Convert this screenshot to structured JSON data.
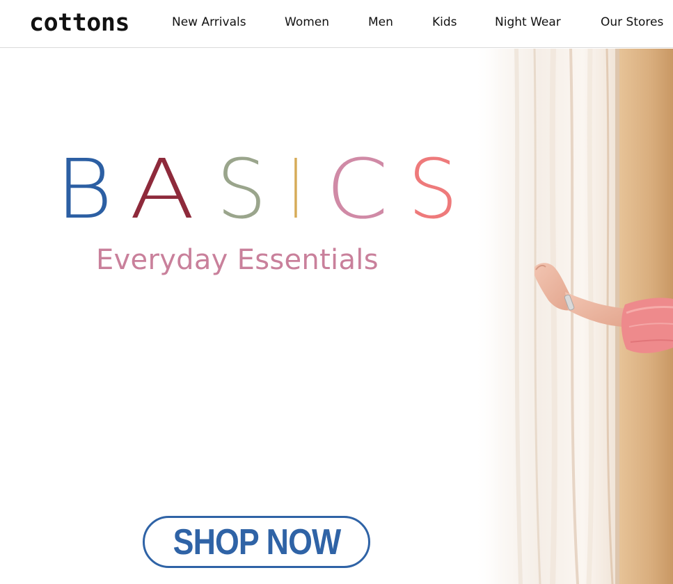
{
  "brand": {
    "logo_text": "cottons"
  },
  "nav": {
    "new_arrivals": "New Arrivals",
    "women": "Women",
    "men": "Men",
    "kids": "Kids",
    "night_wear": "Night Wear",
    "our_stores": "Our Stores"
  },
  "hero": {
    "headline_letters": [
      {
        "char": "B",
        "color": "#2c5fa3"
      },
      {
        "char": "A",
        "color": "#8e2a3b"
      },
      {
        "char": "S",
        "color": "#9aa58c"
      },
      {
        "char": "I",
        "color": "#d6ab58"
      },
      {
        "char": "C",
        "color": "#d08aa6"
      },
      {
        "char": "S",
        "color": "#ee7a7b"
      }
    ],
    "tagline": "Everyday Essentials",
    "cta_label": "SHOP NOW",
    "image_alt": "woman in pink kurta drawing back a white curtain"
  },
  "colors": {
    "tagline": "#c9809b",
    "cta": "#2f63a6",
    "header_border": "#d9d9d9"
  }
}
